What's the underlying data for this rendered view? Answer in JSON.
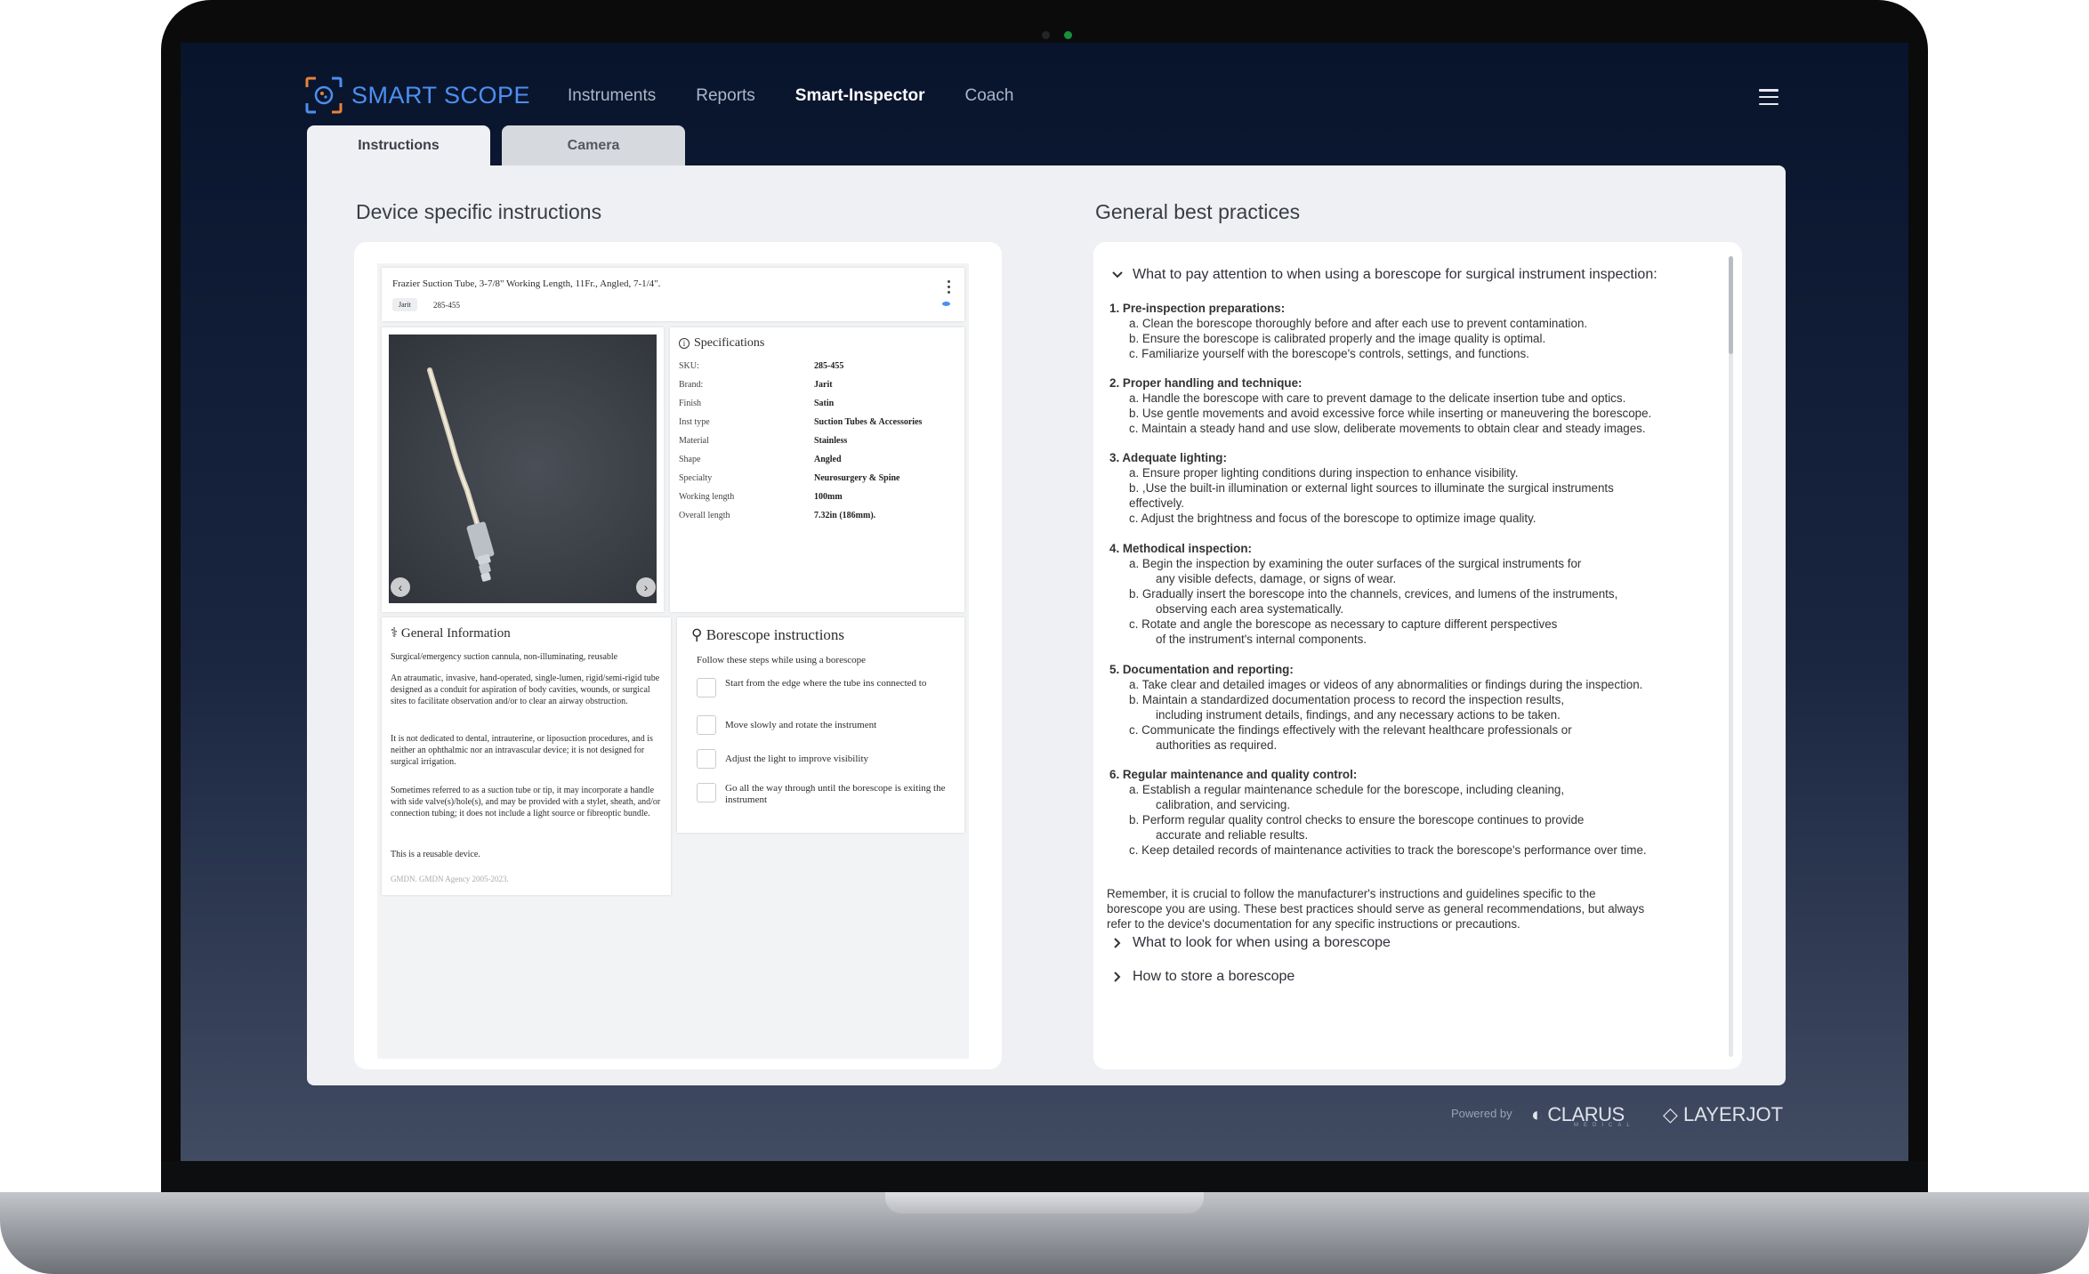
{
  "header": {
    "brand": "SMART SCOPE",
    "nav": [
      {
        "label": "Instruments",
        "active": false
      },
      {
        "label": "Reports",
        "active": false
      },
      {
        "label": "Smart-Inspector",
        "active": true
      },
      {
        "label": "Coach",
        "active": false
      }
    ],
    "menu_icon": "hamburger-menu-icon"
  },
  "tabs": [
    {
      "label": "Instructions",
      "selected": true
    },
    {
      "label": "Camera",
      "selected": false
    }
  ],
  "device_section": {
    "title": "Device specific instructions",
    "device": {
      "name": "Frazier Suction Tube, 3-7/8\" Working Length, 11Fr., Angled, 7-1/4\".",
      "brand_tag": "Jarit",
      "sku": "285-455"
    },
    "specifications": {
      "title": "Specifications",
      "rows": [
        {
          "key": "SKU:",
          "value": "285-455"
        },
        {
          "key": "Brand:",
          "value": "Jarit"
        },
        {
          "key": "Finish",
          "value": "Satin"
        },
        {
          "key": "Inst type",
          "value": "Suction Tubes & Accessories"
        },
        {
          "key": "Material",
          "value": "Stainless"
        },
        {
          "key": "Shape",
          "value": "Angled"
        },
        {
          "key": "Specialty",
          "value": "Neurosurgery & Spine"
        },
        {
          "key": "Working length",
          "value": "100mm"
        },
        {
          "key": "Overall length",
          "value": "7.32in (186mm)."
        }
      ]
    },
    "general_info": {
      "title": "General Information",
      "paragraphs": [
        "Surgical/emergency suction cannula, non-illuminating, reusable",
        "An atraumatic, invasive, hand-operated, single-lumen, rigid/semi-rigid tube designed as a conduit for aspiration of body cavities, wounds, or surgical sites to facilitate observation and/or to clear an airway obstruction.",
        "It is not dedicated to dental, intrauterine, or liposuction procedures, and is neither an ophthalmic nor an intravascular device; it is not designed for surgical irrigation.",
        "Sometimes referred to as a suction tube or tip, it may incorporate a handle with side valve(s)/hole(s), and may be provided with a stylet, sheath, and/or connection tubing; it does not include a light source or fibreoptic bundle.",
        "This is a reusable device."
      ],
      "footer": "GMDN. GMDN Agency 2005-2023."
    },
    "borescope": {
      "title": "Borescope instructions",
      "subtitle": "Follow these steps while using a borescope",
      "steps": [
        "Start from the edge where the tube ins connected to",
        "Move slowly and rotate the instrument",
        "Adjust the light to improve visibility",
        "Go all the way through until the borescope is exiting the instrument"
      ]
    }
  },
  "best_practices": {
    "title": "General best practices",
    "expanded_heading": "What to pay attention to when using a borescope for surgical instrument inspection:",
    "lines": [
      {
        "text": "1. Pre-inspection preparations:",
        "bold": true
      },
      {
        "text": "a. Clean the borescope thoroughly before and after each use to prevent contamination.",
        "bold": false
      },
      {
        "text": "b.  Ensure the borescope is calibrated properly and the image quality is optimal.",
        "bold": false
      },
      {
        "text": "c. Familiarize yourself with the borescope's controls, settings, and functions.",
        "bold": false
      },
      {
        "text": "2.  Proper handling and technique:",
        "bold": true
      },
      {
        "text": "a. Handle the borescope with care to prevent damage to the delicate insertion tube and optics.",
        "bold": false
      },
      {
        "text": "b. Use gentle movements and avoid excessive force while inserting or maneuvering the borescope.",
        "bold": false
      },
      {
        "text": "c. Maintain a steady hand and use slow, deliberate movements to obtain clear and steady images.",
        "bold": false
      },
      {
        "text": "3.  Adequate lighting:",
        "bold": true
      },
      {
        "text": "a. Ensure proper lighting conditions during inspection to enhance visibility.",
        "bold": false
      },
      {
        "text": "b. ,Use the built-in illumination or external light sources to illuminate the surgical instruments",
        "bold": false
      },
      {
        "text": "effectively.",
        "bold": false
      },
      {
        "text": "c. Adjust the brightness and focus of the borescope to optimize image quality.",
        "bold": false
      },
      {
        "text": "4. Methodical inspection:",
        "bold": true
      },
      {
        "text": "a. Begin the inspection by examining the outer surfaces of the surgical instruments for",
        "bold": false
      },
      {
        "text": "any visible defects, damage, or signs of wear.",
        "bold": false
      },
      {
        "text": "b. Gradually insert the borescope into the channels, crevices, and lumens of the instruments,",
        "bold": false
      },
      {
        "text": "observing each area systematically.",
        "bold": false
      },
      {
        "text": "c. Rotate and angle the borescope as necessary to capture different perspectives",
        "bold": false
      },
      {
        "text": "of the instrument's internal components.",
        "bold": false
      },
      {
        "text": "5. Documentation and reporting:",
        "bold": true
      },
      {
        "text": "a. Take clear and detailed images or videos of any abnormalities or findings during the inspection.",
        "bold": false
      },
      {
        "text": "b. Maintain a standardized documentation process to record the inspection results,",
        "bold": false
      },
      {
        "text": "including instrument details, findings, and any necessary actions to be taken.",
        "bold": false
      },
      {
        "text": "c.  Communicate the findings effectively with the relevant healthcare professionals or",
        "bold": false
      },
      {
        "text": "authorities as required.",
        "bold": false
      },
      {
        "text": "6. Regular maintenance and quality control:",
        "bold": true
      },
      {
        "text": "a. Establish a regular maintenance schedule for the borescope, including cleaning,",
        "bold": false
      },
      {
        "text": "calibration, and servicing.",
        "bold": false
      },
      {
        "text": "b.  Perform regular quality control checks to ensure the borescope continues to provide",
        "bold": false
      },
      {
        "text": "accurate and reliable results.",
        "bold": false
      },
      {
        "text": "c. Keep detailed records of maintenance activities to track the borescope's performance over time.",
        "bold": false
      },
      {
        "text": "Remember, it is crucial to follow the manufacturer's instructions and guidelines specific to the",
        "bold": false
      },
      {
        "text": "borescope you are using. These best practices should serve as general recommendations, but always",
        "bold": false
      },
      {
        "text": "refer to the device's documentation for any specific instructions or precautions.",
        "bold": false
      }
    ],
    "collapsed": [
      "What to look for when using a borescope",
      "How to store a borescope"
    ]
  },
  "footer": {
    "powered_by": "Powered by",
    "partner1": "CLARUS",
    "partner1_sub": "MEDICAL",
    "partner2": "LAYERJOT"
  },
  "colors": {
    "brand": "#4d8ff0",
    "logo_accent": "#e9823a",
    "screen_top": "#08142c",
    "panel": "#eef0f4"
  }
}
